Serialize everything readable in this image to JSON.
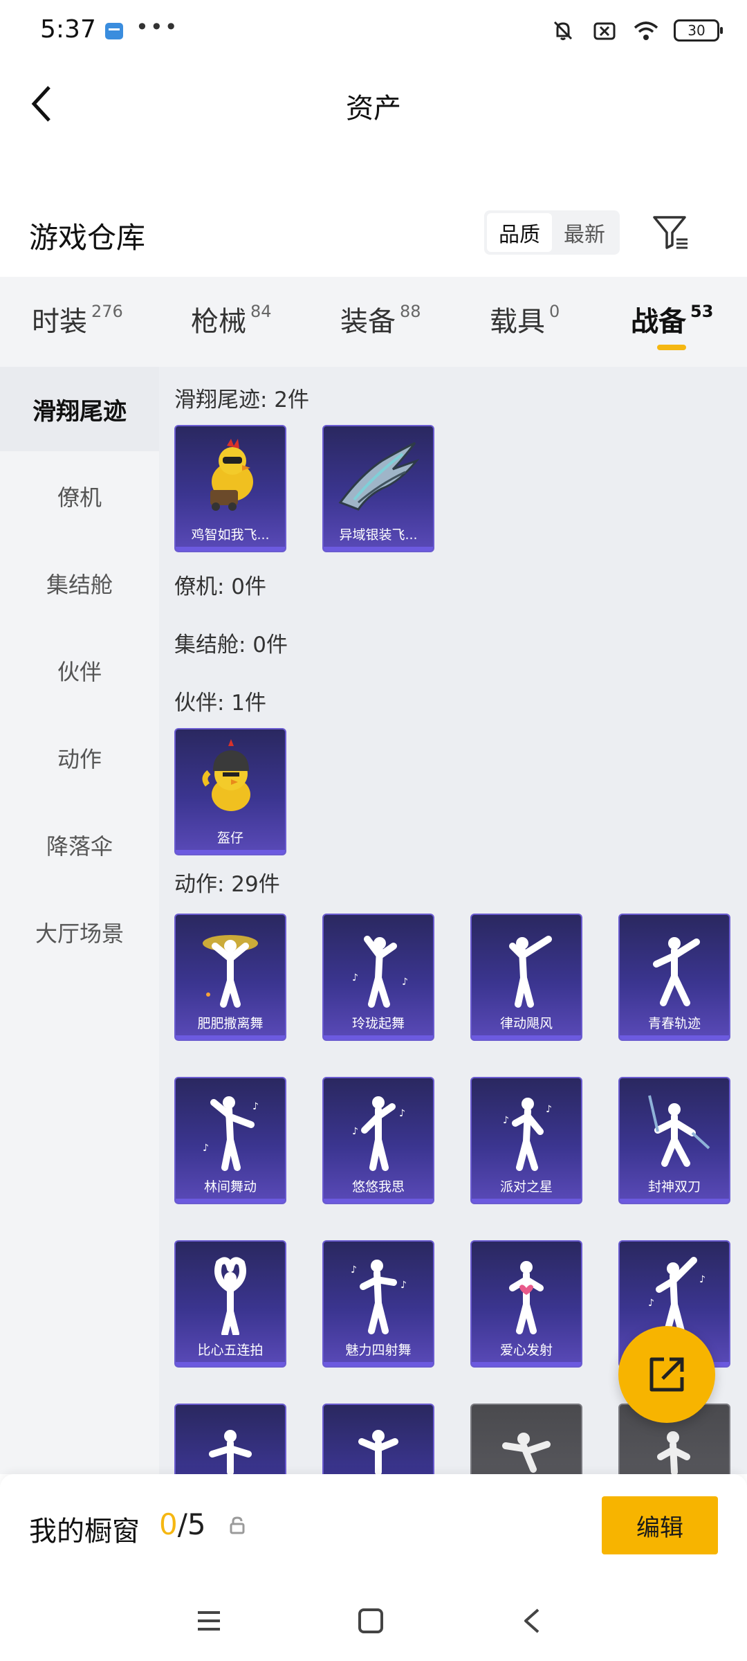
{
  "status_bar": {
    "time": "5:37",
    "dots": "•••",
    "battery": "30"
  },
  "header": {
    "title": "资产"
  },
  "warehouse": {
    "title": "游戏仓库",
    "sort": {
      "quality": "品质",
      "newest": "最新"
    }
  },
  "tabs": [
    {
      "label": "时装",
      "count": "276"
    },
    {
      "label": "枪械",
      "count": "84"
    },
    {
      "label": "装备",
      "count": "88"
    },
    {
      "label": "载具",
      "count": "0"
    },
    {
      "label": "战备",
      "count": "53"
    }
  ],
  "sidebar": {
    "items": [
      "滑翔尾迹",
      "僚机",
      "集结舱",
      "伙伴",
      "动作",
      "降落伞",
      "大厅场景"
    ]
  },
  "sections": {
    "glide": {
      "title": "滑翔尾迹: 2件",
      "items": [
        "鸡智如我飞...",
        "异域银装飞..."
      ]
    },
    "wingman": {
      "title": "僚机: 0件"
    },
    "assembly": {
      "title": "集结舱: 0件"
    },
    "partner": {
      "title": "伙伴: 1件",
      "items": [
        "盔仔"
      ]
    },
    "emote": {
      "title": "动作: 29件",
      "items": [
        "肥肥撒离舞",
        "玲珑起舞",
        "律动飓风",
        "青春轨迹",
        "林间舞动",
        "悠悠我思",
        "派对之星",
        "封神双刀",
        "比心五连拍",
        "魅力四射舞",
        "爱心发射",
        "",
        "",
        "",
        "",
        ""
      ]
    }
  },
  "showcase": {
    "label": "我的橱窗",
    "current": "0",
    "total": "/5",
    "edit": "编辑"
  },
  "colors": {
    "accent": "#f7b400",
    "card_top": "#2a2860",
    "card_bottom": "#5a4ab8"
  }
}
